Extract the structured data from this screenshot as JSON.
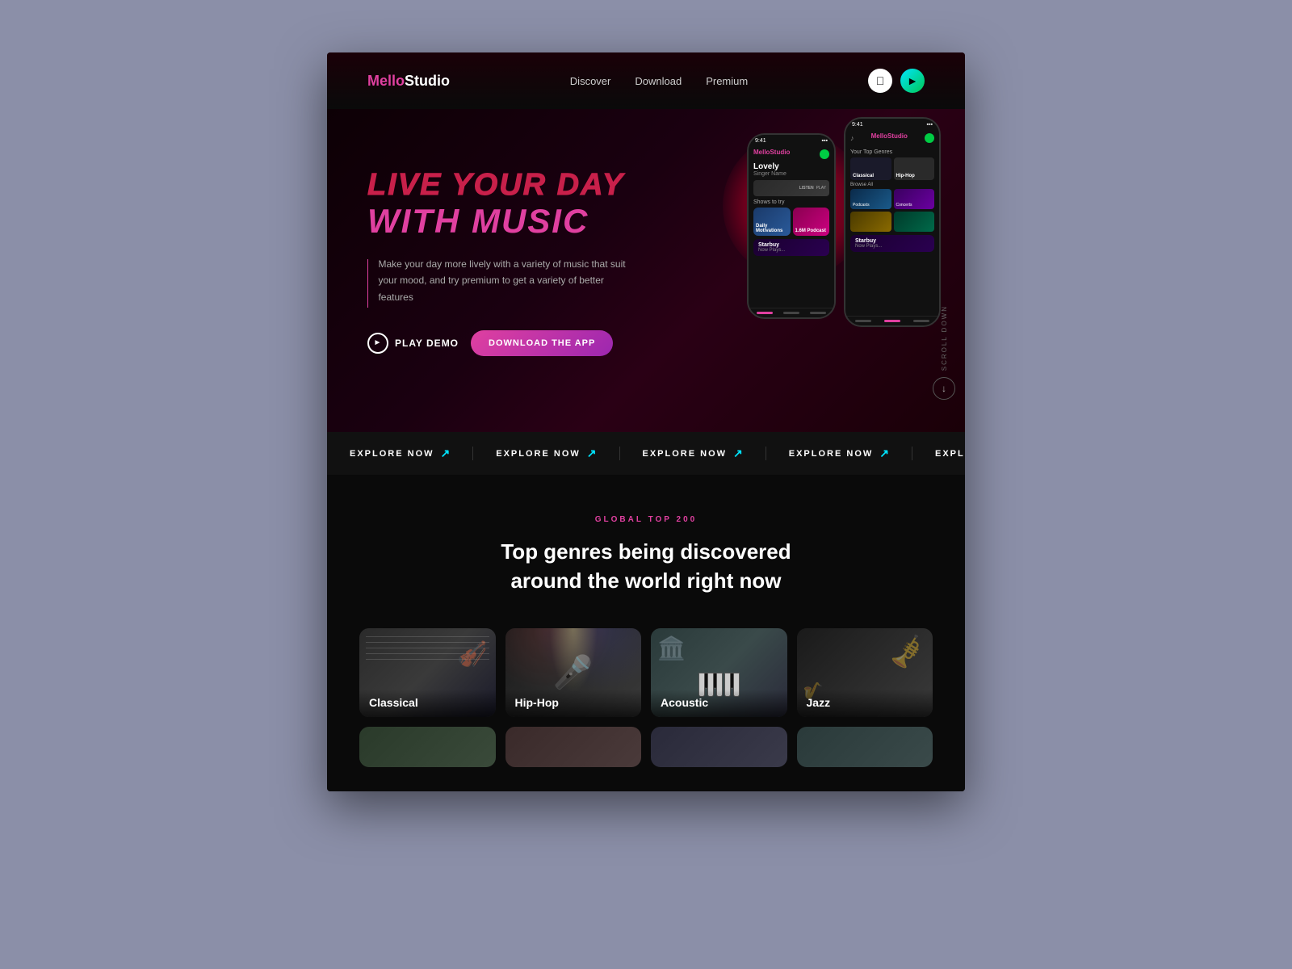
{
  "logo": {
    "mello": "Mello",
    "studio": "Studio"
  },
  "nav": {
    "links": [
      "Discover",
      "Download",
      "Premium"
    ],
    "apple_icon": "⊘",
    "play_icon": "▶"
  },
  "hero": {
    "title_line1": "LIVE YOUR DAY",
    "title_line2": "WITH MUSIC",
    "description": "Make your day more lively with a variety of music that suit your mood, and try premium to get a variety of better features",
    "btn_play": "PLAY DEMO",
    "btn_download": "DOWNLOAD THE APP",
    "scroll_text": "Scroll Down"
  },
  "explore_bar": {
    "items": [
      "EXPLORE NOW",
      "EXPLORE NOW",
      "EXPLORE NOW",
      "EXPLORE NOW",
      "EXPLORE NOW"
    ]
  },
  "genres_section": {
    "tag": "GLOBAL TOP 200",
    "title_line1": "Top genres being discovered",
    "title_line2": "around the world right now",
    "cards": [
      {
        "name": "Classical",
        "type": "classical"
      },
      {
        "name": "Hip-Hop",
        "type": "hiphop"
      },
      {
        "name": "Acoustic",
        "type": "acoustic"
      },
      {
        "name": "Jazz",
        "type": "jazz"
      }
    ],
    "partial_cards": [
      {
        "type": "gc-partial-1"
      },
      {
        "type": "gc-partial-2"
      },
      {
        "type": "gc-partial-3"
      },
      {
        "type": "gc-partial-4"
      }
    ]
  },
  "phone_left": {
    "time": "9:41",
    "brand": "MelloStudio",
    "song": "Lovely",
    "artist": "Singer Name",
    "shows_label": "Shows to try",
    "now_playing": "Starbuy",
    "np_sub": "Now Plays..."
  },
  "phone_right": {
    "time": "9:41",
    "brand": "MelloStudio",
    "top_genres_label": "Your Top Genres",
    "classical": "Classical",
    "hiphop": "Hip-Hop",
    "browse_label": "Browse All",
    "podcasts": "Podcasts",
    "concerts": "Concerts",
    "now_playing": "Starbuy",
    "np_sub": "Now Plays..."
  }
}
